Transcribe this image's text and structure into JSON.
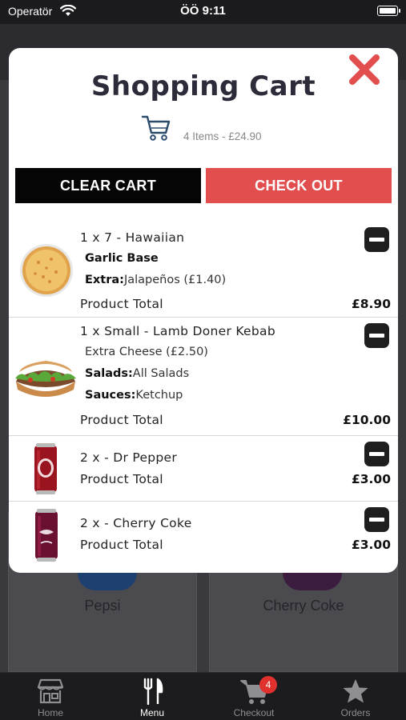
{
  "status_bar": {
    "carrier": "Operatör",
    "time": "ÖÖ 9:11"
  },
  "background": {
    "card_1_label": "Pepsi",
    "card_2_label": "Cherry Coke"
  },
  "modal": {
    "title": "Shopping Cart",
    "summary": "4 Items - £24.90",
    "clear_label": "CLEAR CART",
    "checkout_label": "CHECK OUT",
    "items": [
      {
        "title": "1 x 7 - Hawaiian",
        "base": "Garlic Base",
        "extra_label": "Extra:",
        "extra_value": "Jalapeños (£1.40)",
        "total_label": "Product Total",
        "total": "£8.90",
        "image": "pizza"
      },
      {
        "title": "1 x Small - Lamb Doner Kebab",
        "extra": "Extra Cheese (£2.50)",
        "salads_label": "Salads:",
        "salads_value": "All Salads",
        "sauces_label": "Sauces:",
        "sauces_value": "Ketchup",
        "total_label": "Product Total",
        "total": "£10.00",
        "image": "kebab"
      },
      {
        "title": "2 x - Dr Pepper",
        "total_label": "Product Total",
        "total": "£3.00",
        "image": "dr-pepper-can"
      },
      {
        "title": "2 x - Cherry Coke",
        "total_label": "Product Total",
        "total": "£3.00",
        "image": "cherry-coke-can"
      }
    ]
  },
  "tab_bar": {
    "tabs": [
      {
        "label": "Home",
        "icon": "store-icon"
      },
      {
        "label": "Menu",
        "icon": "utensils-icon"
      },
      {
        "label": "Checkout",
        "icon": "cart-icon",
        "badge": "4"
      },
      {
        "label": "Orders",
        "icon": "star-icon"
      }
    ],
    "active": "Menu"
  },
  "colors": {
    "accent_red": "#e24d4d",
    "dark": "#050505",
    "badge": "#e0312f"
  }
}
